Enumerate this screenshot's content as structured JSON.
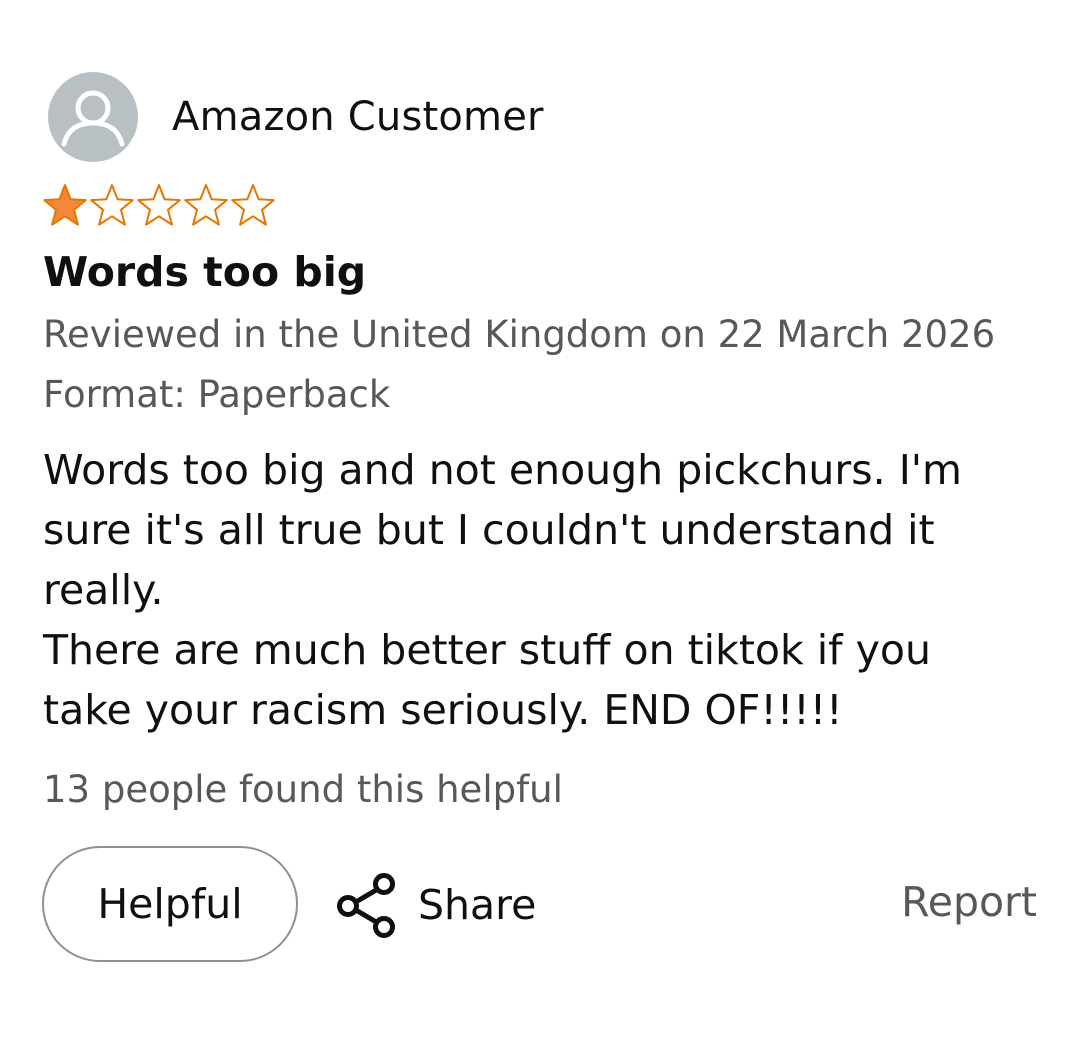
{
  "review": {
    "author": "Amazon Customer",
    "rating": 1,
    "rating_max": 5,
    "star_color": "#f3883a",
    "title": "Words too big",
    "date_line": "Reviewed in the United Kingdom on 22 March 2026",
    "format_line": "Format: Paperback",
    "body_lines": [
      "Words too big and not enough pickchurs. I'm",
      "sure it's all true but I couldn't understand it",
      "really.",
      "There are much better stuff on tiktok if you",
      "take your racism seriously. END OF!!!!!"
    ],
    "helpful_count_text": "13 people found this helpful"
  },
  "actions": {
    "helpful_label": "Helpful",
    "share_label": "Share",
    "report_label": "Report"
  },
  "icons": {
    "avatar": "user-avatar-icon",
    "share": "share-icon",
    "star_filled": "star-filled-icon",
    "star_empty": "star-empty-icon"
  }
}
